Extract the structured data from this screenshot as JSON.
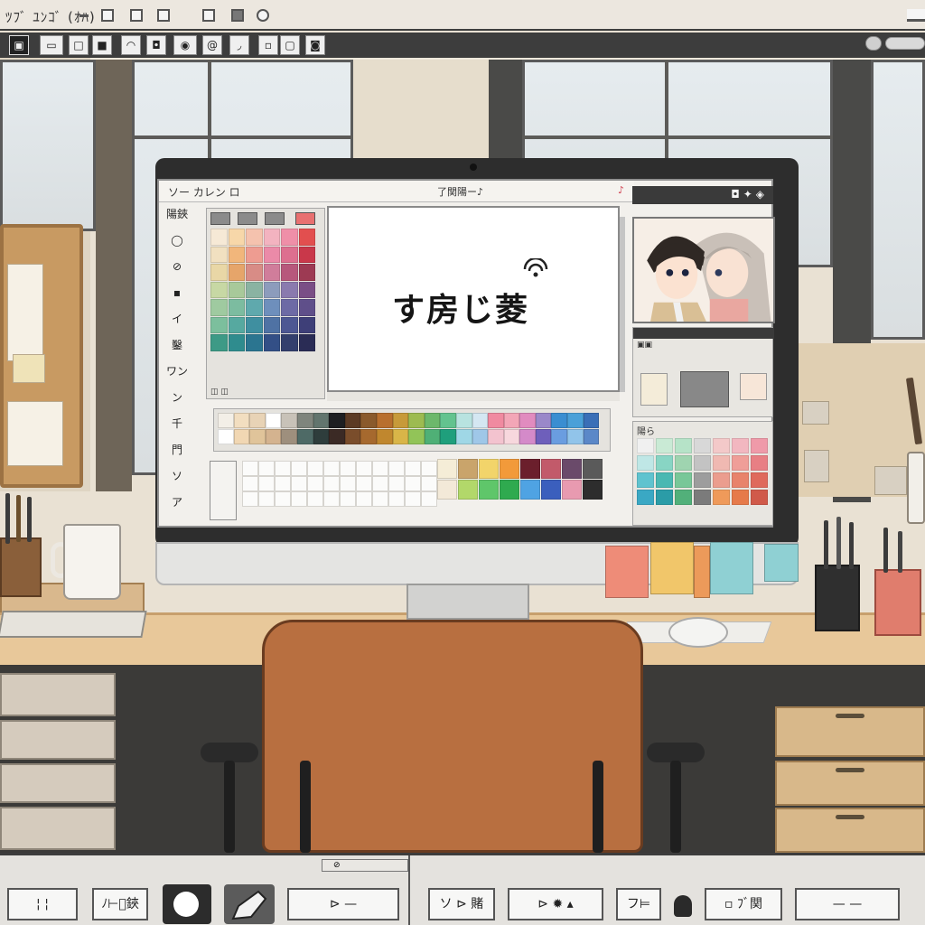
{
  "top_menubar": {
    "garbled_title": "ﾂﾌﾞ ﾕﾝｺﾞ (ｵﾊ)"
  },
  "top_toolbar": {
    "icons": [
      "frame-icon",
      "square-icon",
      "rectangle-icon",
      "square-outline-icon",
      "pen-curve-icon",
      "stamp-icon",
      "circle-dot-icon",
      "at-sign-icon",
      "brush-stroke-icon",
      "square-small-icon",
      "rounded-square-icon",
      "layer-icon"
    ]
  },
  "app": {
    "title_left": "ソー カレン ロ",
    "title_center": "了関陽ー♪",
    "left_rail": [
      "陽鋏",
      "◯",
      "⊘",
      "▪",
      "イ",
      "鑿",
      "ワン",
      "ン",
      "千",
      "門",
      "ソ",
      "ア"
    ],
    "canvas_text": "す房じ菱",
    "canvas_footer": "◫ ◫",
    "brush_panel_label": "▣▣",
    "mixer_label": "陽ら"
  },
  "colors": {
    "swatch_grid": [
      "#f6e9d6",
      "#f7d7a9",
      "#f5c2ae",
      "#f3b3c0",
      "#ef8fa8",
      "#e24f4f",
      "#f1e0c0",
      "#f1b67b",
      "#ee9c91",
      "#eb8aa8",
      "#dd6f8f",
      "#c9384a",
      "#e9d7a6",
      "#e6a56a",
      "#d88c86",
      "#d07d9b",
      "#b7587c",
      "#9d3a53",
      "#c7d8a4",
      "#a8c99a",
      "#8ab3a2",
      "#8c9cbc",
      "#8a7aae",
      "#7a4e86",
      "#9fcaa0",
      "#7cbca0",
      "#5fa9ad",
      "#6e8fbc",
      "#6d6aa5",
      "#5f4f8a",
      "#7cbf9d",
      "#56a9a0",
      "#3f8fa0",
      "#4f72a4",
      "#4d5793",
      "#3e3f78",
      "#3d9a86",
      "#2f8c8e",
      "#2b7590",
      "#334f86",
      "#333f6d",
      "#2a2c55"
    ],
    "palette_row1": [
      "#f3efe7",
      "#f2dec0",
      "#e8d3b6",
      "#ffffff",
      "#c8c2b8",
      "#7f857d",
      "#62756e",
      "#1e1f22",
      "#5b3a24",
      "#8a5a2c",
      "#b86f2e",
      "#c79a3a",
      "#9dbb51",
      "#6db86b",
      "#63c38f",
      "#b8e3e0",
      "#d4e7f2",
      "#f08aa0",
      "#f3a6b7",
      "#e18bbf",
      "#9a88c9",
      "#3a8ed1",
      "#4aa0d8",
      "#3a6fb7"
    ],
    "palette_row2": [
      "#ffffff",
      "#f1d7b3",
      "#e0c49a",
      "#d4b38f",
      "#9e8f7d",
      "#4e6a66",
      "#2e3d3c",
      "#3b2a25",
      "#7a4d2b",
      "#a6692e",
      "#c0872e",
      "#d9b548",
      "#92c458",
      "#4fb076",
      "#1f9f7c",
      "#9fd7e6",
      "#9fc7e8",
      "#f3c3cf",
      "#f7d7dd",
      "#d48ac9",
      "#6e5fbb",
      "#6a9de0",
      "#91c4ea",
      "#5b88c8"
    ],
    "small_palette": [
      "#f5edd7",
      "#c9a46b",
      "#f2d46a",
      "#f29a3a",
      "#6b1f2c",
      "#c25a6a",
      "#6a4a6a",
      "#5a5a5a",
      "#f3e9d8",
      "#b2d86a",
      "#5fc66a",
      "#2faa4f",
      "#4fa3e3",
      "#3b5fbd",
      "#e89ab0",
      "#2d2d2d"
    ],
    "mixer_grid": [
      "#f0f0f0",
      "#c9ead5",
      "#b6e3c8",
      "#d8d8d8",
      "#f3c9c9",
      "#f2b7c0",
      "#ef9aa9",
      "#bfe7e6",
      "#88d5c4",
      "#9fd4b0",
      "#c3c3c3",
      "#f0b9b2",
      "#ef9e98",
      "#e87f84",
      "#5fc3cf",
      "#4ab8b2",
      "#78c798",
      "#9d9d9d",
      "#eb9d8e",
      "#e8836b",
      "#df6a5c",
      "#3aa8c4",
      "#2b9ca7",
      "#52b07a",
      "#7b7b7b",
      "#ef9a5a",
      "#e67a4a",
      "#d05a4a"
    ],
    "accent_monitor": "#2d2d2d",
    "chair": "#b86f40"
  },
  "bottom_bar": {
    "tab_label": "⊘",
    "btn1": "¦ ¦",
    "btn2": "ﾉ⊢ﾞ鋏",
    "btn3": "⊳ —",
    "btn4": "ソ ⊳ 賭",
    "btn5": "⊳ ✹ ▴",
    "btn6": "フ⊨",
    "btn7": "▫ ﾌﾞ関",
    "btn8": "— —"
  }
}
